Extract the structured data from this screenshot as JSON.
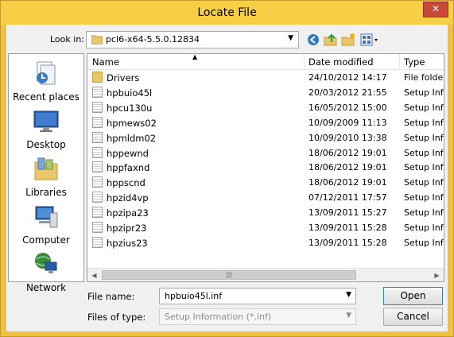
{
  "window": {
    "title": "Locate File",
    "close_glyph": "✕"
  },
  "lookin": {
    "label": "Look in:",
    "value": "pcl6-x64-5.5.0.12834",
    "icons": [
      "back-icon",
      "up-folder-icon",
      "new-folder-icon",
      "view-menu-icon"
    ]
  },
  "places": [
    {
      "label": "Recent places",
      "icon": "recent-places-icon"
    },
    {
      "label": "Desktop",
      "icon": "desktop-icon"
    },
    {
      "label": "Libraries",
      "icon": "libraries-icon"
    },
    {
      "label": "Computer",
      "icon": "computer-icon"
    },
    {
      "label": "Network",
      "icon": "network-icon"
    }
  ],
  "columns": {
    "name": "Name",
    "date": "Date modified",
    "type": "Type"
  },
  "files": [
    {
      "name": "Drivers",
      "date": "24/10/2012 14:17",
      "type": "File folder",
      "kind": "folder"
    },
    {
      "name": "hpbuio45l",
      "date": "20/03/2012 21:55",
      "type": "Setup Infc",
      "kind": "file"
    },
    {
      "name": "hpcu130u",
      "date": "16/05/2012 15:00",
      "type": "Setup Infc",
      "kind": "file"
    },
    {
      "name": "hpmews02",
      "date": "10/09/2009 11:13",
      "type": "Setup Infc",
      "kind": "file"
    },
    {
      "name": "hpmldm02",
      "date": "10/09/2010 13:38",
      "type": "Setup Infc",
      "kind": "file"
    },
    {
      "name": "hppewnd",
      "date": "18/06/2012 19:01",
      "type": "Setup Infc",
      "kind": "file"
    },
    {
      "name": "hppfaxnd",
      "date": "18/06/2012 19:01",
      "type": "Setup Infc",
      "kind": "file"
    },
    {
      "name": "hppscnd",
      "date": "18/06/2012 19:01",
      "type": "Setup Infc",
      "kind": "file"
    },
    {
      "name": "hpzid4vp",
      "date": "07/12/2011 17:57",
      "type": "Setup Infc",
      "kind": "file"
    },
    {
      "name": "hpzipa23",
      "date": "13/09/2011 15:27",
      "type": "Setup Infc",
      "kind": "file"
    },
    {
      "name": "hpzipr23",
      "date": "13/09/2011 15:28",
      "type": "Setup Infc",
      "kind": "file"
    },
    {
      "name": "hpzius23",
      "date": "13/09/2011 15:28",
      "type": "Setup Infc",
      "kind": "file"
    }
  ],
  "filename": {
    "label": "File name:",
    "value": "hpbuio45l.inf"
  },
  "filetype": {
    "label": "Files of type:",
    "value": "Setup Information (*.inf)"
  },
  "buttons": {
    "open": "Open",
    "cancel": "Cancel"
  },
  "colors": {
    "title_bar": "#f7cf45",
    "close_button": "#c8483a"
  }
}
